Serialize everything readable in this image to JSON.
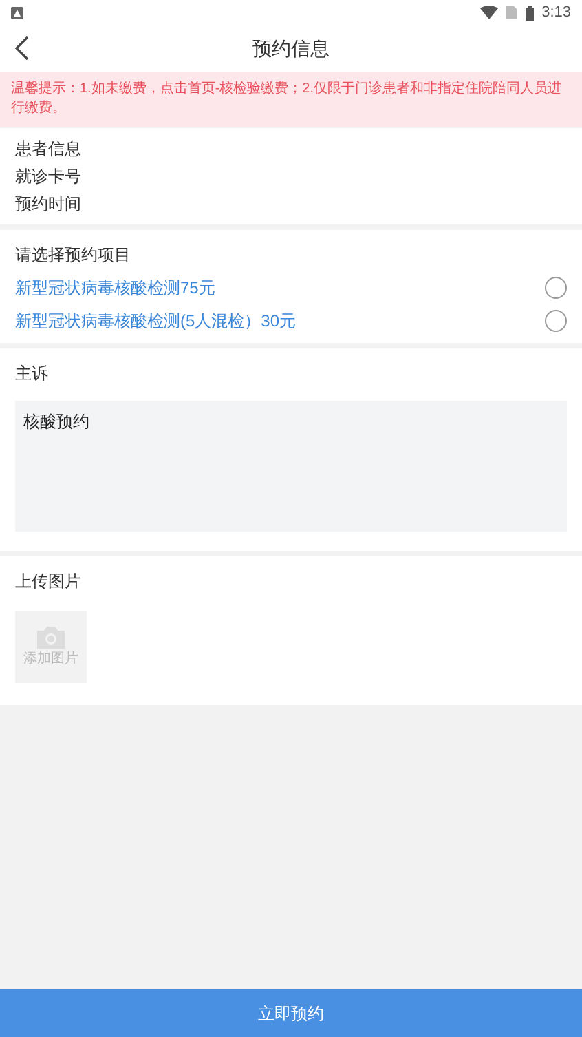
{
  "status_bar": {
    "time": "3:13"
  },
  "header": {
    "title": "预约信息"
  },
  "notice": "温馨提示：1.如未缴费，点击首页-核检验缴费；2.仅限于门诊患者和非指定住院陪同人员进行缴费。",
  "patient_info": [
    "患者信息",
    "就诊卡号",
    "预约时间"
  ],
  "items_section": {
    "title": "请选择预约项目",
    "options": [
      {
        "label": "新型冠状病毒核酸检测75元",
        "selected": false
      },
      {
        "label": "新型冠状病毒核酸检测(5人混检）30元",
        "selected": false
      }
    ]
  },
  "complaint": {
    "title": "主诉",
    "value": "核酸预约"
  },
  "upload": {
    "title": "上传图片",
    "button_label": "添加图片"
  },
  "submit_button": "立即预约"
}
